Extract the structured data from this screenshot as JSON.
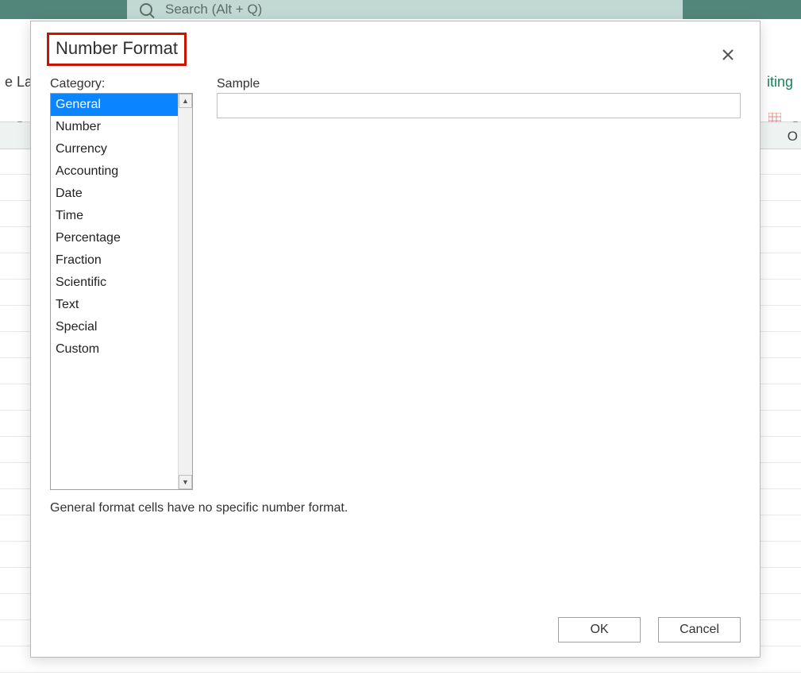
{
  "background": {
    "search_placeholder": "Search (Alt + Q)",
    "left_tab_fragment": "e Lay",
    "right_tab_fragment": "iting",
    "column_letter": "O"
  },
  "dialog": {
    "title": "Number Format",
    "category_label": "Category:",
    "sample_label": "Sample",
    "sample_value": "",
    "description": "General format cells have no specific number format.",
    "ok_label": "OK",
    "cancel_label": "Cancel",
    "categories": [
      "General",
      "Number",
      "Currency",
      "Accounting",
      "Date",
      "Time",
      "Percentage",
      "Fraction",
      "Scientific",
      "Text",
      "Special",
      "Custom"
    ],
    "selected_category_index": 0
  }
}
